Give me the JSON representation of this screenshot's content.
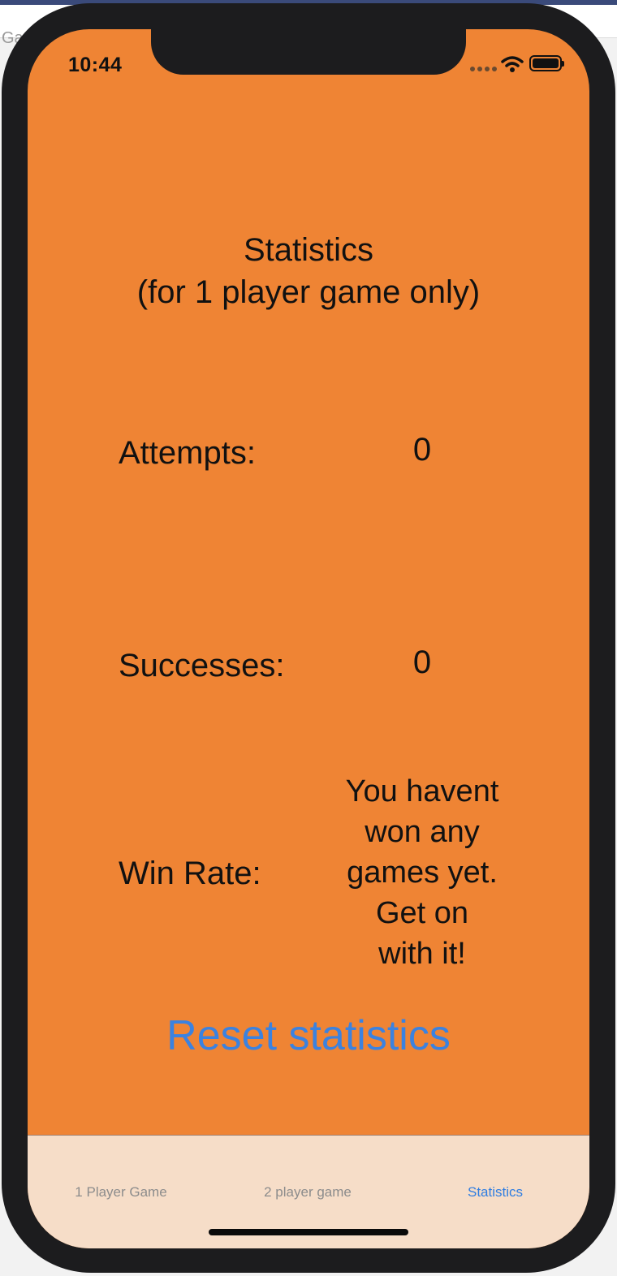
{
  "host": {
    "partial_text": "Ga"
  },
  "status_bar": {
    "time": "10:44"
  },
  "header": {
    "title_line1": "Statistics",
    "title_line2": "(for 1 player game only)"
  },
  "stats": {
    "attempts_label": "Attempts:",
    "attempts_value": "0",
    "successes_label": "Successes:",
    "successes_value": "0",
    "win_rate_label": "Win Rate:",
    "win_rate_lines": [
      "You havent",
      "won any",
      "games yet.",
      "Get on",
      "with it!"
    ]
  },
  "actions": {
    "reset_label": "Reset statistics"
  },
  "tabs": [
    {
      "label": "1 Player Game",
      "active": false
    },
    {
      "label": "2 player game",
      "active": false
    },
    {
      "label": "Statistics",
      "active": true
    }
  ],
  "colors": {
    "background": "#ef8434",
    "tabbar": "#f6ddc8",
    "accent": "#3b82e0"
  }
}
